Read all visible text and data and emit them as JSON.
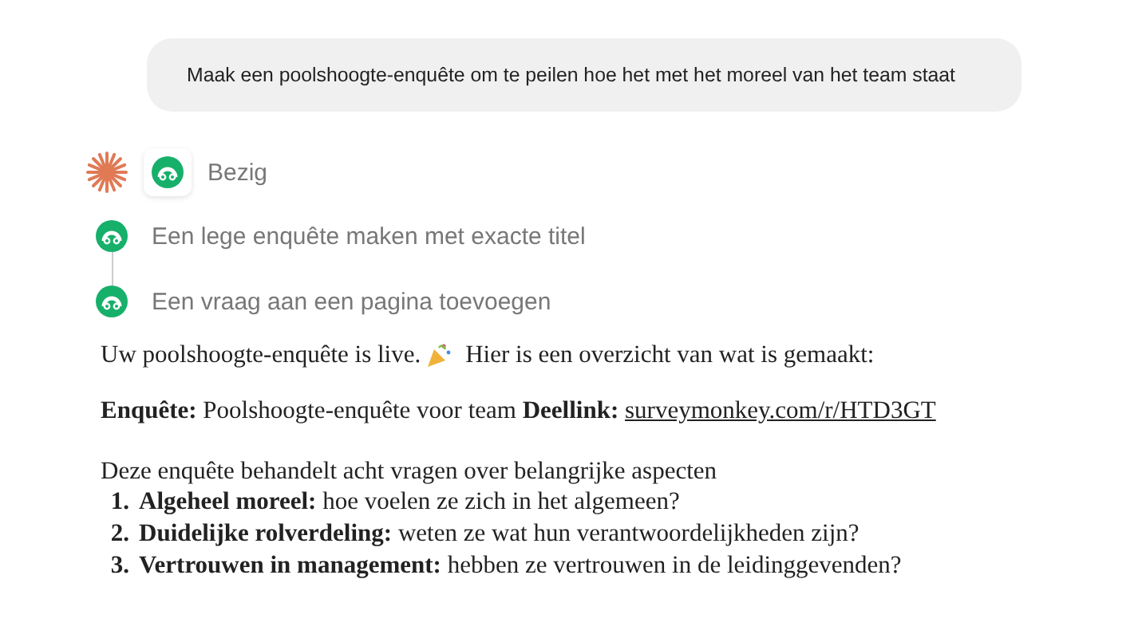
{
  "user_message": {
    "text": "Maak een poolshoogte-enquête om te peilen hoe het met het moreel van het team staat"
  },
  "status": {
    "label": "Bezig"
  },
  "steps": [
    {
      "label": "Een lege enquête maken met exacte titel"
    },
    {
      "label": "Een vraag aan een pagina toevoegen"
    }
  ],
  "reply": {
    "intro": "Uw poolshoogte-enquête is live.",
    "intro_after": "Hier is een overzicht van wat is gemaakt:",
    "summary": "**Enquête:** Poolshoogte-enquête voor team **Deellink:**",
    "link": "surveymonkey.com/r/HTD3GT",
    "list_intro": "Deze enquête behandelt acht vragen over belangrijke aspecten",
    "items": [
      {
        "number": "1.",
        "title": "Algeheel moreel:",
        "text": "hoe voelen ze zich in het algemeen?"
      },
      {
        "number": "2.",
        "title": "Duidelijke rolverdeling:",
        "text": "weten ze wat hun verantwoordelijkheden zijn?"
      },
      {
        "number": "3.",
        "title": "Vertrouwen in management:",
        "text": "hebben ze vertrouwen in de leidinggevenden?"
      }
    ]
  }
}
